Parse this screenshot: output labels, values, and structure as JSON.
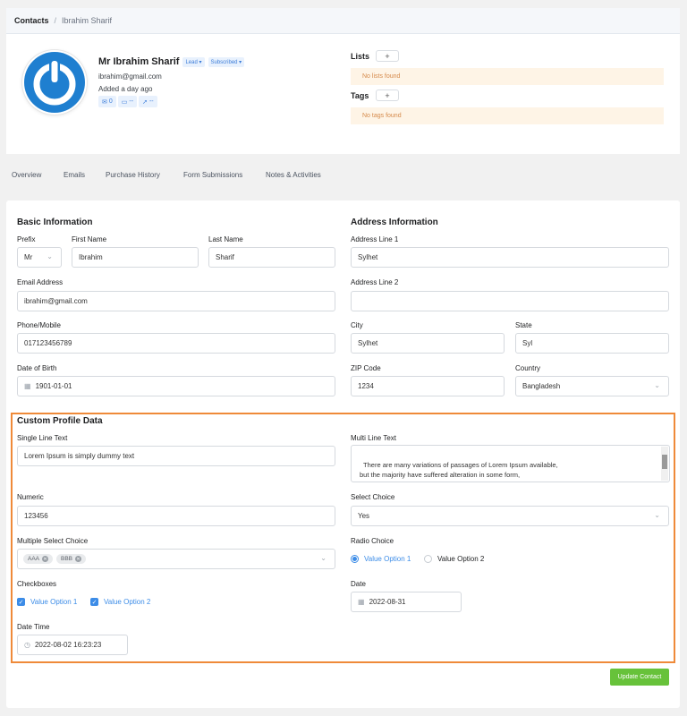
{
  "breadcrumb": {
    "root": "Contacts",
    "separator": "/",
    "current": "Ibrahim Sharif"
  },
  "profile": {
    "name": "Mr Ibrahim Sharif",
    "status_badge": "Lead ▾",
    "subscription_badge": "Subscribed ▾",
    "email": "ibrahim@gmail.com",
    "added": "Added a day ago",
    "stats": {
      "emails": "0",
      "folder": "--",
      "send": "--"
    }
  },
  "lists": {
    "label": "Lists",
    "add": "+",
    "empty": "No lists found"
  },
  "tags": {
    "label": "Tags",
    "add": "+",
    "empty": "No tags found"
  },
  "tabs": [
    "Overview",
    "Emails",
    "Purchase History",
    "Form Submissions",
    "Notes & Activities"
  ],
  "basic": {
    "title": "Basic Information",
    "prefix": {
      "label": "Prefix",
      "value": "Mr"
    },
    "first_name": {
      "label": "First Name",
      "value": "Ibrahim"
    },
    "last_name": {
      "label": "Last Name",
      "value": "Sharif"
    },
    "email": {
      "label": "Email Address",
      "value": "ibrahim@gmail.com"
    },
    "phone": {
      "label": "Phone/Mobile",
      "value": "017123456789"
    },
    "dob": {
      "label": "Date of Birth",
      "value": "1901-01-01"
    }
  },
  "address": {
    "title": "Address Information",
    "line1": {
      "label": "Address Line 1",
      "value": "Sylhet"
    },
    "line2": {
      "label": "Address Line 2",
      "value": ""
    },
    "city": {
      "label": "City",
      "value": "Sylhet"
    },
    "state": {
      "label": "State",
      "value": "Syl"
    },
    "zip": {
      "label": "ZIP Code",
      "value": "1234"
    },
    "country": {
      "label": "Country",
      "value": "Bangladesh"
    }
  },
  "custom": {
    "title": "Custom Profile Data",
    "single_line": {
      "label": "Single Line Text",
      "value": "Lorem Ipsum is simply dummy text"
    },
    "multi_line": {
      "label": "Multi Line Text",
      "value": "There are many variations of passages of Lorem Ipsum available,\nbut the majority have suffered alteration in some form,\n  by injected humour, or randomised words which don't look even slightly believable."
    },
    "numeric": {
      "label": "Numeric",
      "value": "123456"
    },
    "select": {
      "label": "Select Choice",
      "value": "Yes"
    },
    "multi_select": {
      "label": "Multiple Select Choice",
      "values": [
        "AAA",
        "BBB"
      ]
    },
    "radio": {
      "label": "Radio Choice",
      "options": [
        "Value Option 1",
        "Value Option 2"
      ],
      "selected": 0
    },
    "checkboxes": {
      "label": "Checkboxes",
      "options": [
        "Value Option 1",
        "Value Option 2"
      ]
    },
    "date": {
      "label": "Date",
      "value": "2022-08-31"
    },
    "datetime": {
      "label": "Date Time",
      "value": "2022-08-02 16:23:23"
    }
  },
  "actions": {
    "update": "Update Contact"
  },
  "colors": {
    "accent": "#3c8ce7",
    "highlight_border": "#ef8a39",
    "update_button": "#67c23a",
    "avatar_blue": "#1f7fd0"
  }
}
